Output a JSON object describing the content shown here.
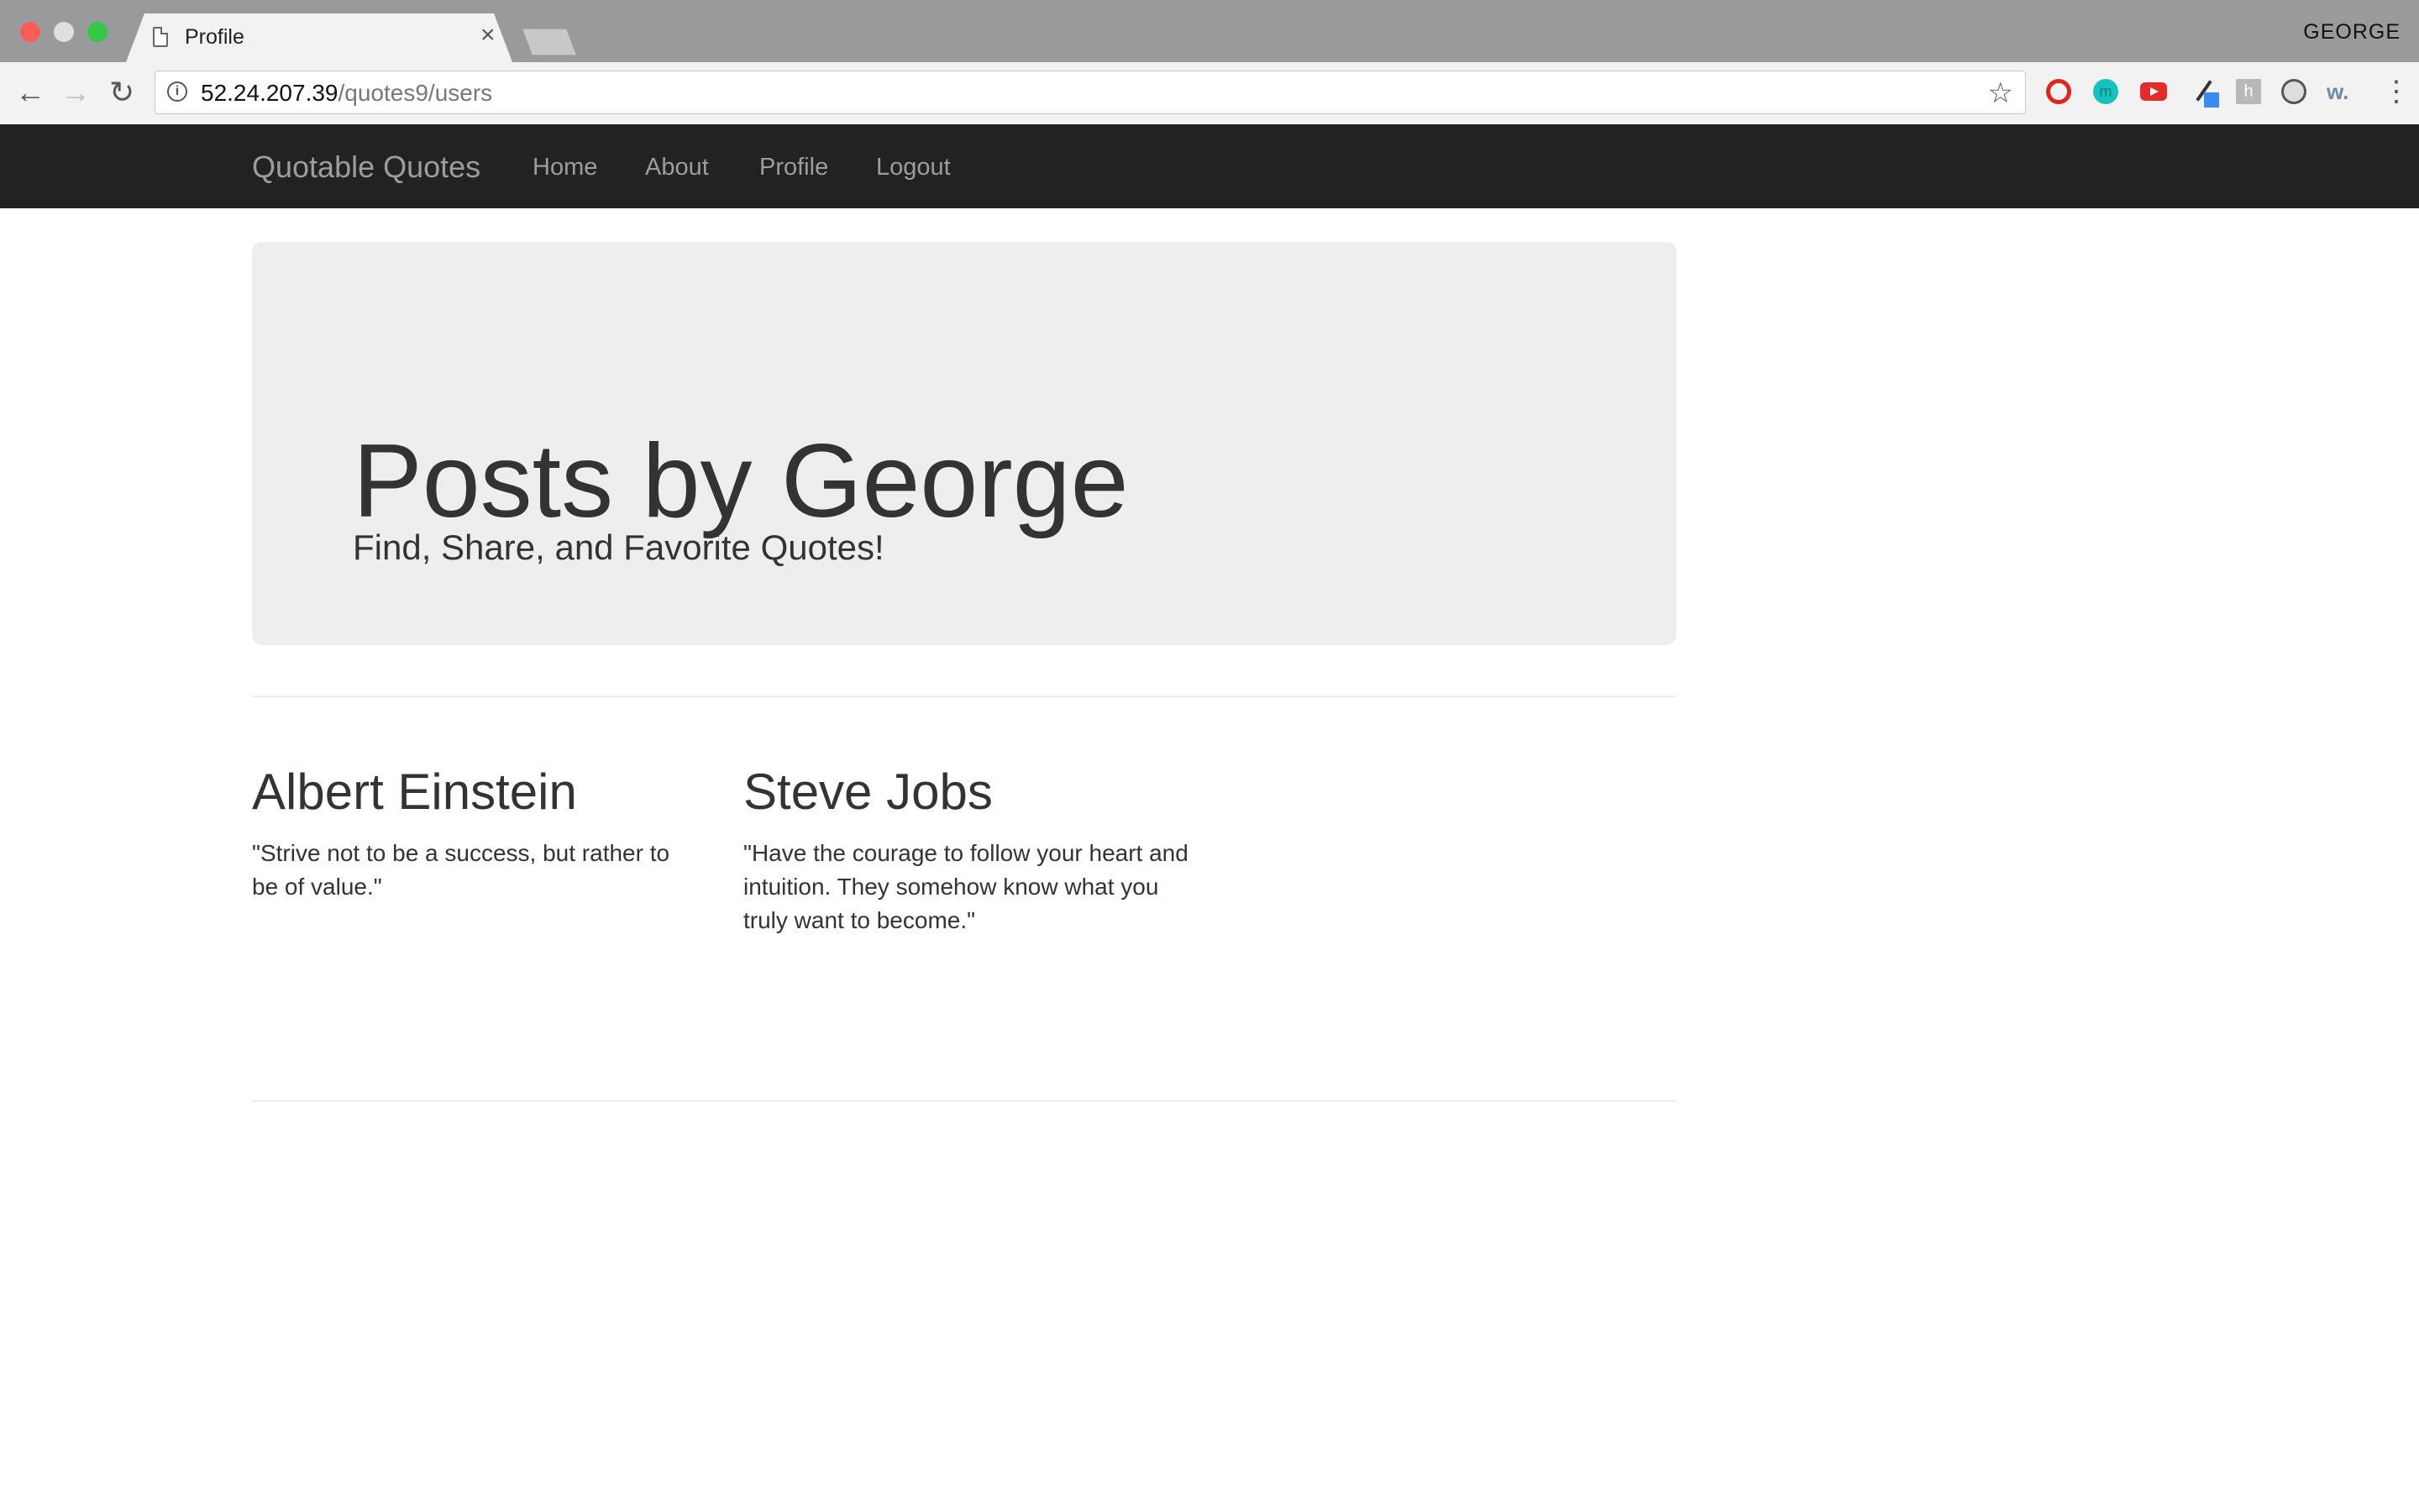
{
  "browser": {
    "tab_title": "Profile",
    "tab_close": "×",
    "profile_name": "GEORGE",
    "url_host": "52.24.207.39",
    "url_path": "/quotes9/users",
    "extension_m_label": "m",
    "extension_h_label": "h",
    "extension_w_label": "w."
  },
  "site": {
    "brand": "Quotable Quotes",
    "nav": [
      "Home",
      "About",
      "Profile",
      "Logout"
    ]
  },
  "jumbotron": {
    "title": "Posts by George",
    "subtitle": "Find, Share, and Favorite Quotes!"
  },
  "quotes": [
    {
      "author": "Albert Einstein",
      "text": "\"Strive not to be a success, but rather to be of value.\""
    },
    {
      "author": "Steve Jobs",
      "text": "\"Have the courage to follow your heart and intuition. They somehow know what you truly want to become.\""
    }
  ],
  "colors": {
    "navbar_bg": "#222222",
    "navbar_text": "#9d9d9d",
    "jumbotron_bg": "#eeeeee"
  }
}
